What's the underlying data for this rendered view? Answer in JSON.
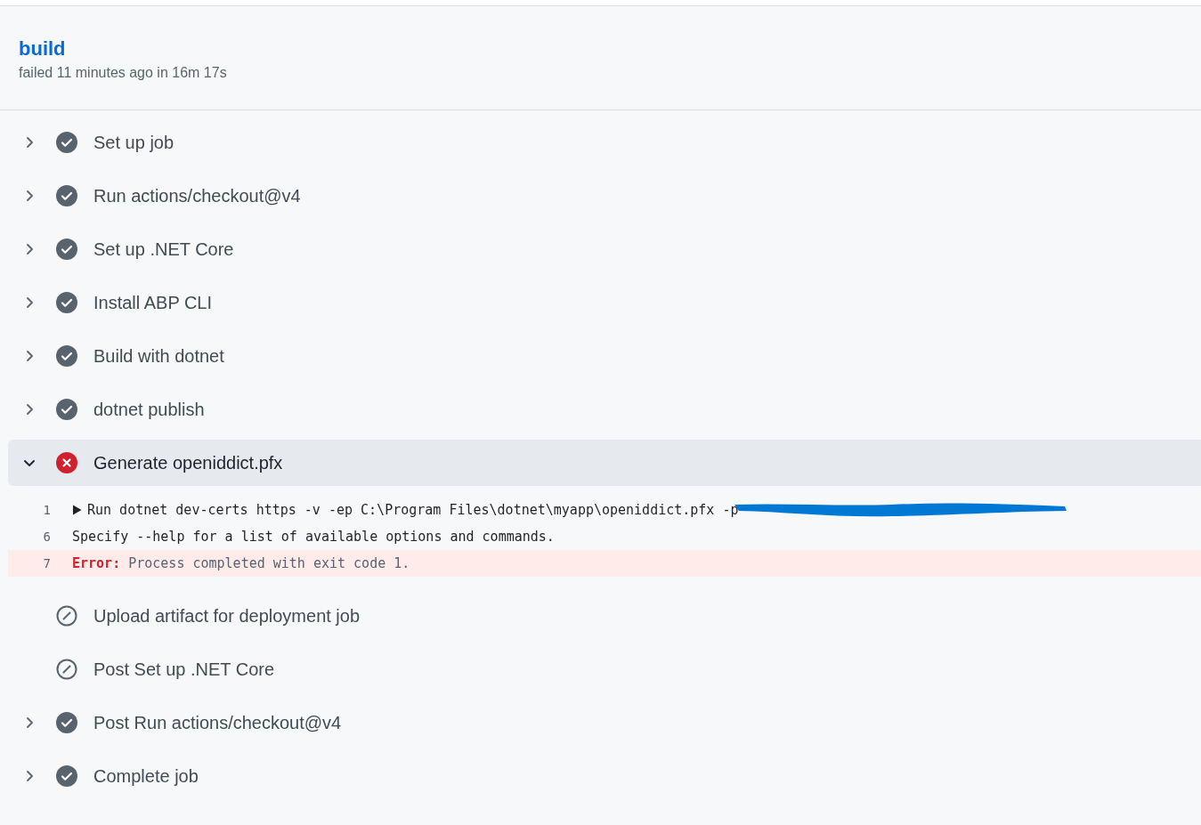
{
  "job": {
    "title": "build",
    "summary": "failed 11 minutes ago in 16m 17s"
  },
  "steps": [
    {
      "name": "Set up job",
      "kind": "success",
      "expanded": false
    },
    {
      "name": "Run actions/checkout@v4",
      "kind": "success",
      "expanded": false
    },
    {
      "name": "Set up .NET Core",
      "kind": "success",
      "expanded": false
    },
    {
      "name": "Install ABP CLI",
      "kind": "success",
      "expanded": false
    },
    {
      "name": "Build with dotnet",
      "kind": "success",
      "expanded": false
    },
    {
      "name": "dotnet publish",
      "kind": "success",
      "expanded": false
    },
    {
      "name": "Generate openiddict.pfx",
      "kind": "failure",
      "expanded": true,
      "log": [
        {
          "number": "1",
          "kind": "group",
          "text": "Run dotnet dev-certs https -v -ep C:\\Program Files\\dotnet\\myapp\\openiddict.pfx -p",
          "redacted": true
        },
        {
          "number": "6",
          "kind": "plain",
          "text": "Specify --help for a list of available options and commands.",
          "redacted": false
        },
        {
          "number": "7",
          "kind": "error",
          "text": "**Error:** Process completed with exit code 1.",
          "redacted": false
        }
      ]
    },
    {
      "name": "Upload artifact for deployment job",
      "kind": "skipped",
      "expanded": false
    },
    {
      "name": "Post Set up .NET Core",
      "kind": "skipped",
      "expanded": false
    },
    {
      "name": "Post Run actions/checkout@v4",
      "kind": "success",
      "expanded": false
    },
    {
      "name": "Complete job",
      "kind": "success",
      "expanded": false
    }
  ]
}
